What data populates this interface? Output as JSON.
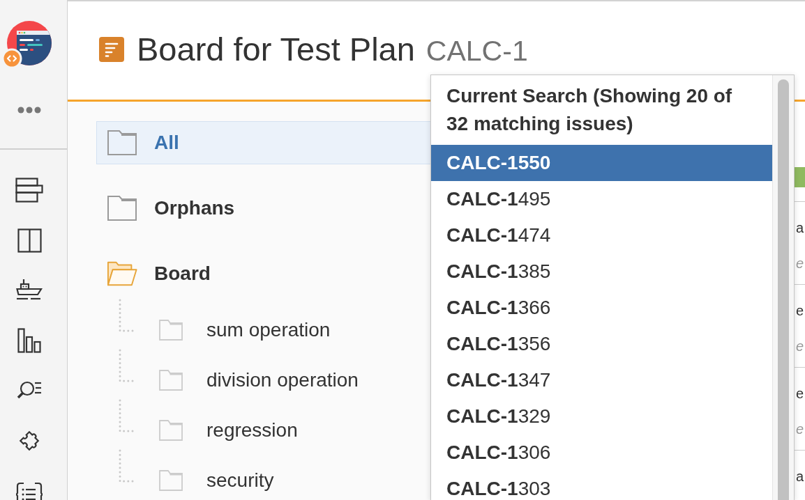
{
  "header": {
    "title": "Board for Test Plan",
    "issue_key": "CALC-1"
  },
  "tree": {
    "items": [
      {
        "label": "All",
        "selected": true,
        "expanded": false
      },
      {
        "label": "Orphans",
        "selected": false,
        "expanded": false
      },
      {
        "label": "Board",
        "selected": false,
        "expanded": true,
        "children": [
          {
            "label": "sum operation",
            "selected": false,
            "expanded": false
          },
          {
            "label": "division operation",
            "selected": false,
            "expanded": false
          },
          {
            "label": "regression",
            "selected": false,
            "expanded": false
          },
          {
            "label": "security",
            "selected": false,
            "expanded": false
          }
        ]
      }
    ]
  },
  "issue_list": {
    "rows": [
      {
        "title": "a",
        "subtitle": "e"
      },
      {
        "title": "e",
        "subtitle": "e"
      },
      {
        "title": "e",
        "subtitle": "e"
      },
      {
        "title": "a"
      }
    ]
  },
  "search_dropdown": {
    "heading": "Current Search (Showing 20 of 32 matching issues)",
    "items": [
      {
        "label": "**CALC-1**550",
        "selected": true
      },
      {
        "label": "**CALC-1**495",
        "selected": false
      },
      {
        "label": "**CALC-1**474",
        "selected": false
      },
      {
        "label": "**CALC-1**385",
        "selected": false
      },
      {
        "label": "**CALC-1**366",
        "selected": false
      },
      {
        "label": "**CALC-1**356",
        "selected": false
      },
      {
        "label": "**CALC-1**347",
        "selected": false
      },
      {
        "label": "**CALC-1**329",
        "selected": false
      },
      {
        "label": "**CALC-1**306",
        "selected": false
      },
      {
        "label": "**CALC-1**303",
        "selected": false
      }
    ]
  }
}
